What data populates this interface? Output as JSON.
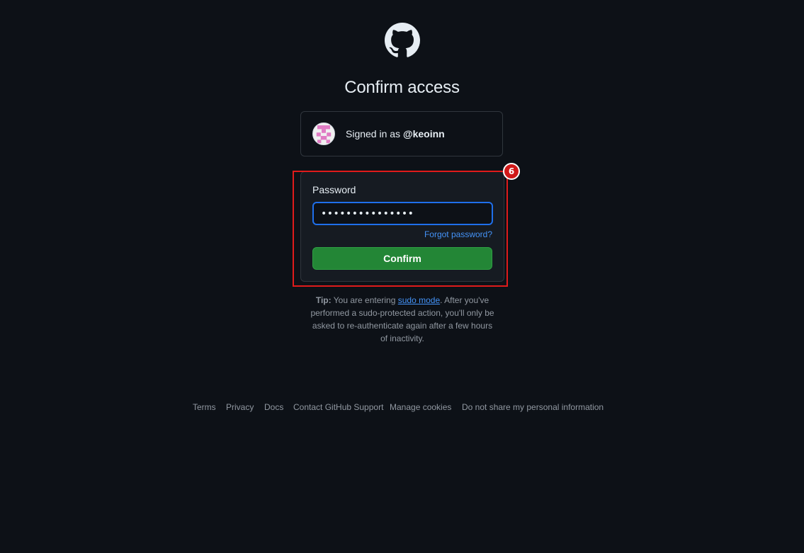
{
  "page": {
    "title": "Confirm access",
    "logo_icon": "github-mark-icon"
  },
  "account": {
    "signed_in_prefix": "Signed in as",
    "username": "@keoinn",
    "avatar_icon": "identicon-avatar"
  },
  "form": {
    "password_label": "Password",
    "password_value": "•••••••••••••••",
    "forgot_label": "Forgot password?",
    "confirm_label": "Confirm"
  },
  "annotation": {
    "badge_number": "6",
    "highlight_color": "#e01b1b"
  },
  "tip": {
    "label": "Tip:",
    "text_before": "You are entering",
    "link_text": "sudo mode",
    "text_after": ". After you've performed a sudo-protected action, you'll only be asked to re-authenticate again after a few hours of inactivity."
  },
  "footer": {
    "links": [
      "Terms",
      "Privacy",
      "Docs",
      "Contact GitHub Support",
      "Manage cookies",
      "Do not share my personal information"
    ]
  },
  "colors": {
    "background": "#0d1117",
    "accent_green": "#238636",
    "link_blue": "#4493f8",
    "focus_blue": "#1f6feb"
  }
}
